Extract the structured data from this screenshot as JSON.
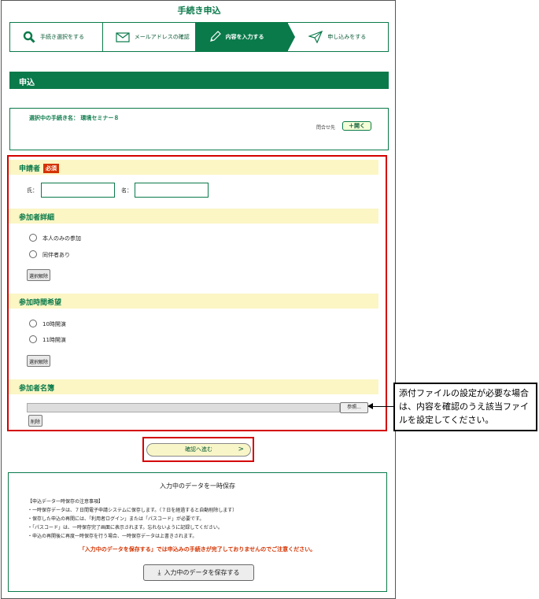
{
  "page_title": "手続き申込",
  "steps": [
    {
      "label": "手続き選択をする",
      "icon": "search-icon",
      "active": false
    },
    {
      "label": "メールアドレスの確認",
      "icon": "mail-icon",
      "active": false
    },
    {
      "label": "内容を入力する",
      "icon": "pencil-icon",
      "active": true
    },
    {
      "label": "申し込みをする",
      "icon": "send-icon",
      "active": false
    }
  ],
  "section_title": "申込",
  "selected": {
    "label": "選択中の手続き名： 環境セミナー８",
    "contact_label": "問合せ先",
    "open_button": "＋開く"
  },
  "form": {
    "applicant": {
      "heading": "申請者",
      "required_badge": "必須",
      "last_name_label": "氏：",
      "first_name_label": "名：",
      "last_name_value": "",
      "first_name_value": ""
    },
    "participant_detail": {
      "heading": "参加者詳細",
      "options": [
        "本人のみの参加",
        "同伴者あり"
      ],
      "clear_button": "選択解除"
    },
    "time_preference": {
      "heading": "参加時間希望",
      "options": [
        "10時開演",
        "11時開演"
      ],
      "clear_button": "選択解除"
    },
    "participant_list": {
      "heading": "参加者名簿",
      "browse_button": "参照...",
      "delete_button": "削除"
    }
  },
  "confirm_button": "確認へ進む",
  "temp_save": {
    "title": "入力中のデータを一時保存",
    "notes": [
      "【申込データ一時保存の注意事項】",
      "・一時保存データは、７日間電子申請システムに保存します。（７日を経過すると自動削除します）",
      "・保存した申込の再開には、「利用者ログイン」または「パスコード」が必要です。",
      "・「パスコード」は、一時保存完了画面に表示されます。忘れないように記録してください。",
      "・申込の再開後に再度一時保存を行う場合、一時保存データは上書きされます。"
    ],
    "warning": "「入力中のデータを保存する」では申込みの手続きが完了しておりませんのでご注意ください。",
    "save_button": "入力中のデータを保存する"
  },
  "callout": "添付ファイルの設定が必要な場合は、内容を確認のうえ該当ファイルを設定してください。",
  "colors": {
    "brand_green": "#0a7a4a",
    "highlight_red": "#d40000",
    "heading_bg": "#fbf6c4"
  }
}
